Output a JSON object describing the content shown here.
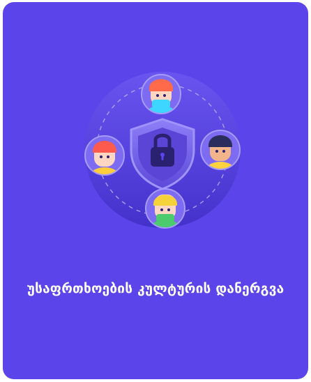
{
  "card": {
    "title": "უსაფრთხოების კულტურის დანერგვა",
    "background_color": "#5b45ea"
  },
  "illustration": {
    "icons": [
      "shield-icon",
      "padlock-icon",
      "person-avatar-icon"
    ],
    "avatar_colors": {
      "top": {
        "hair": "#ff6b4a",
        "face": "#ffd6c2",
        "body": "#3cd6ff"
      },
      "right": {
        "hair": "#2b2e5c",
        "face": "#f2b48a",
        "body": "#ffd23f"
      },
      "bottom": {
        "hair": "#f5d23a",
        "face": "#ffd6c2",
        "body": "#4ccb6e"
      },
      "left": {
        "hair": "#ff5a4e",
        "face": "#ffd6c2",
        "body": "#ffce3a"
      }
    }
  }
}
